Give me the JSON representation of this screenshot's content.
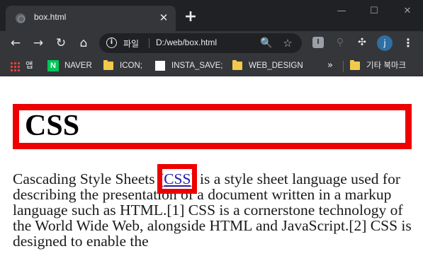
{
  "browser": {
    "tab": {
      "title": "box.html",
      "close_glyph": "✕"
    },
    "new_tab_glyph": "+",
    "window_controls": {
      "minimize": "—",
      "maximize": "☐",
      "close": "✕"
    },
    "toolbar": {
      "back": "←",
      "forward": "→",
      "reload": "↻",
      "home": "⌂",
      "scheme_label": "파일",
      "url": "D:/web/box.html",
      "zoom_glyph": "🔍",
      "star_glyph": "☆",
      "extension_i": "I",
      "key_glyph": "⚲",
      "puzzle_glyph": "✣",
      "avatar_letter": "j",
      "menu_glyph": "⋮"
    },
    "bookmarks": {
      "apps_label": "앱",
      "items": [
        {
          "label": "NAVER",
          "icon": "naver-icon"
        },
        {
          "label": "ICON;",
          "icon": "folder-icon"
        },
        {
          "label": "INSTA_SAVE;",
          "icon": "white-page-icon"
        },
        {
          "label": "WEB_DESIGN",
          "icon": "folder-icon"
        }
      ],
      "more_glyph": "»",
      "other_bookmarks": "기타 북마크"
    }
  },
  "page": {
    "heading": "CSS",
    "paragraph": {
      "before_link": "Cascading Style Sheets (",
      "link_text": "CSS",
      "after_link": ") is a style sheet language used for describing the presentation of a document written in a markup language such as HTML.[1] CSS is a cornerstone technology of the World Wide Web, alongside HTML and JavaScript.[2] CSS is designed to enable the"
    }
  },
  "colors": {
    "chrome_dark": "#202124",
    "chrome_toolbar": "#35363a",
    "box_border": "#ee0000",
    "link": "#1f1aa6",
    "naver_green": "#03c75a",
    "avatar_blue": "#2f6fa3"
  }
}
